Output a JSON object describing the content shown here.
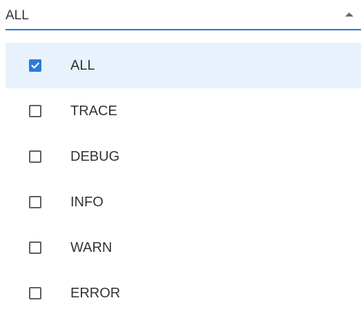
{
  "select": {
    "value": "ALL",
    "expanded": true,
    "icon": "caret-up-icon"
  },
  "menu": {
    "options": [
      {
        "label": "ALL",
        "checked": true,
        "highlighted": true
      },
      {
        "label": "TRACE",
        "checked": false,
        "highlighted": false
      },
      {
        "label": "DEBUG",
        "checked": false,
        "highlighted": false
      },
      {
        "label": "INFO",
        "checked": false,
        "highlighted": false
      },
      {
        "label": "WARN",
        "checked": false,
        "highlighted": false
      },
      {
        "label": "ERROR",
        "checked": false,
        "highlighted": false
      }
    ]
  },
  "colors": {
    "accent": "#1f77d4",
    "checkbox_checked": "#2b7bd6",
    "highlight_bg": "#e8f2fc",
    "text": "#333333"
  }
}
